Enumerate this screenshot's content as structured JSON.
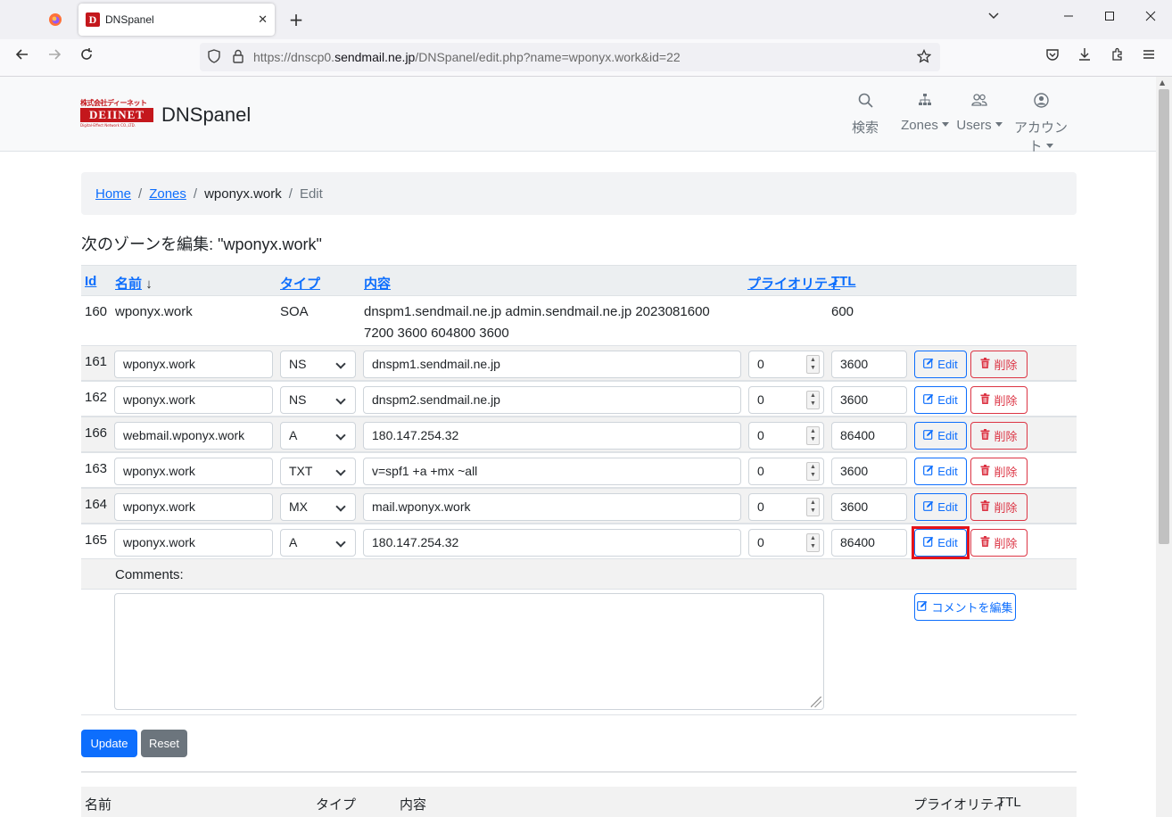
{
  "browser": {
    "tab_title": "DNSpanel",
    "tab_close": "✕",
    "new_tab": "+",
    "url_prefix": "https://dnscp0.",
    "url_domain": "sendmail.ne.jp",
    "url_path": "/DNSpanel/edit.php?name=wponyx.work&id=22",
    "favicon_letter": "D"
  },
  "header": {
    "logo_top": "株式会社ディーネット",
    "logo_mid": "DEIINET",
    "logo_bottom": "Digital-Effect Network CO.,LTD.",
    "brand": "DNSpanel",
    "nav": {
      "search": "検索",
      "zones": "Zones",
      "users": "Users",
      "account": "アカウント"
    }
  },
  "breadcrumb": {
    "home": "Home",
    "zones": "Zones",
    "zone": "wponyx.work",
    "current": "Edit",
    "sep": "/"
  },
  "page_title": "次のゾーンを編集: \"wponyx.work\"",
  "table": {
    "headers": {
      "id": "Id",
      "name": "名前",
      "sort_icon": "↓",
      "type": "タイプ",
      "content": "内容",
      "priority": "プライオリティ",
      "ttl": "TTL"
    },
    "soa": {
      "id": "160",
      "name": "wponyx.work",
      "type": "SOA",
      "content_line1": "dnspm1.sendmail.ne.jp admin.sendmail.ne.jp 2023081600",
      "content_line2": "7200 3600 604800 3600",
      "ttl": "600"
    },
    "records": [
      {
        "id": "161",
        "name": "wponyx.work",
        "type": "NS",
        "content": "dnspm1.sendmail.ne.jp",
        "priority": "0",
        "ttl": "3600"
      },
      {
        "id": "162",
        "name": "wponyx.work",
        "type": "NS",
        "content": "dnspm2.sendmail.ne.jp",
        "priority": "0",
        "ttl": "3600"
      },
      {
        "id": "166",
        "name": "webmail.wponyx.work",
        "type": "A",
        "content": "180.147.254.32",
        "priority": "0",
        "ttl": "86400"
      },
      {
        "id": "163",
        "name": "wponyx.work",
        "type": "TXT",
        "content": "v=spf1 +a +mx ~all",
        "priority": "0",
        "ttl": "3600"
      },
      {
        "id": "164",
        "name": "wponyx.work",
        "type": "MX",
        "content": "mail.wponyx.work",
        "priority": "0",
        "ttl": "3600"
      },
      {
        "id": "165",
        "name": "wponyx.work",
        "type": "A",
        "content": "180.147.254.32",
        "priority": "0",
        "ttl": "86400"
      }
    ],
    "edit_label": "Edit",
    "delete_label": "削除"
  },
  "comments": {
    "label": "Comments:",
    "value": "",
    "edit_button": "コメントを編集"
  },
  "form": {
    "update": "Update",
    "reset": "Reset"
  },
  "bottom_table": {
    "name": "名前",
    "type": "タイプ",
    "content": "内容",
    "priority": "プライオリティ",
    "ttl": "TTL"
  },
  "colors": {
    "primary": "#0d6efd",
    "danger": "#dc3545",
    "secondary": "#6c757d",
    "highlight": "#e5141a",
    "brand_red": "#c4171c"
  }
}
